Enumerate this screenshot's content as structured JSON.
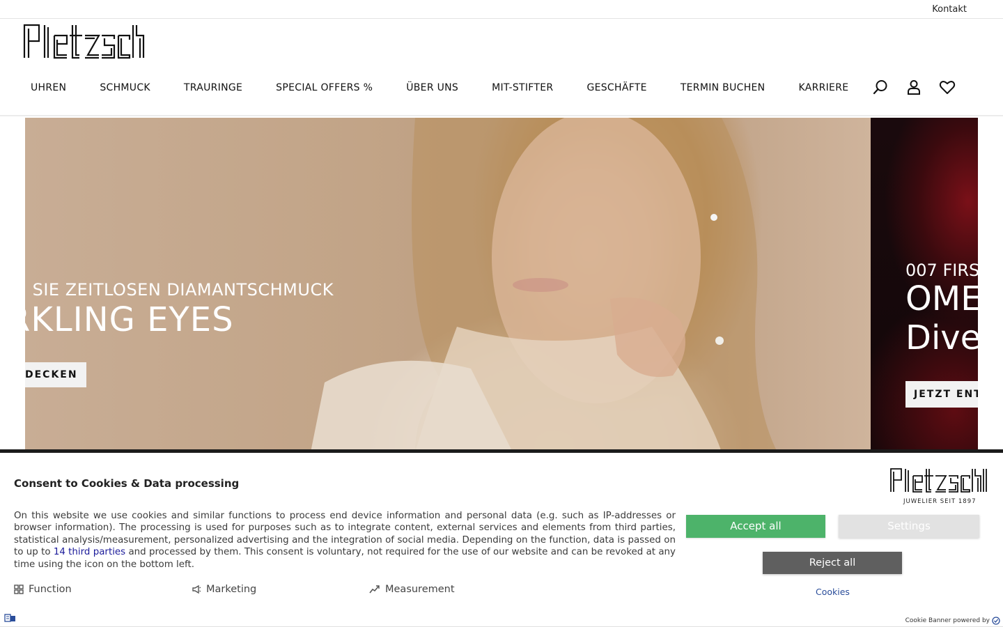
{
  "topbar": {
    "contact_label": "Kontakt"
  },
  "header": {
    "brand": "Pletzsch",
    "nav": [
      "UHREN",
      "SCHMUCK",
      "TRAURINGE",
      "SPECIAL OFFERS %",
      "ÜBER UNS",
      "MIT-STIFTER",
      "GESCHÄFTE",
      "TERMIN BUCHEN",
      "KARRIERE"
    ],
    "icons": [
      "search-icon",
      "user-icon",
      "heart-icon"
    ]
  },
  "hero": {
    "slide1": {
      "subtitle": "N SIE ZEITLOSEN DIAMANTSCHMUCK",
      "headline": "RKLING EYES",
      "cta": "DECKEN"
    },
    "slide2": {
      "subtitle": "007 FIRS",
      "headline_line1": "OME",
      "headline_line2": "Dive",
      "cta": "JETZT ENT"
    }
  },
  "cookie_banner": {
    "title": "Consent to Cookies & Data processing",
    "text_before_link": "On this website we use cookies and similar functions to process end device information and personal data (e.g. such as IP-addresses or browser information). The processing is used for purposes such as to integrate content, external services and elements from third parties, statistical analysis/measurement, personalized advertising and the integration of social media. Depending on the function, data is passed on to up to ",
    "link_text": "14 third parties",
    "text_after_link": " and processed by them. This consent is voluntary, not required for the use of our website and can be revoked at any time using the icon on the bottom left.",
    "categories": [
      "Function",
      "Marketing",
      "Measurement"
    ],
    "logo_brand": "Pletzsch",
    "logo_tagline": "JUWELIER SEIT 1897",
    "accept_label": "Accept all",
    "settings_label": "Settings",
    "reject_label": "Reject all",
    "cookies_link": "Cookies",
    "powered_by": "Cookie Banner powered by",
    "colors": {
      "accept": "#4db36a",
      "reject": "#5f5f5f",
      "settings": "#e2e2e2"
    }
  }
}
